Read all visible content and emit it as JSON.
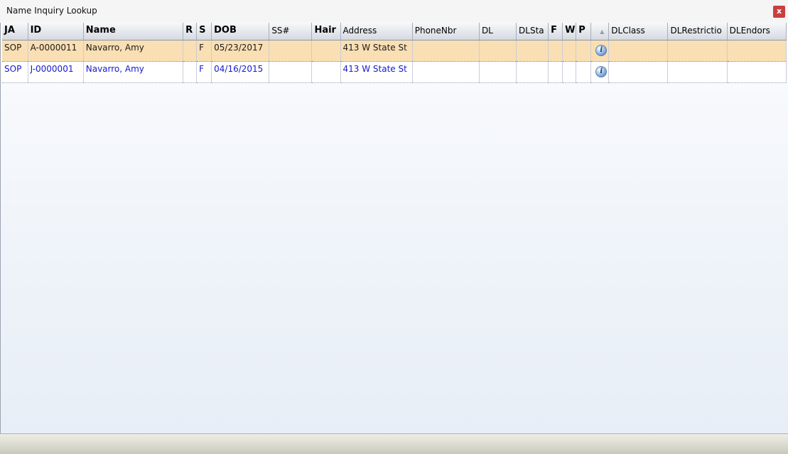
{
  "window": {
    "title": "Name Inquiry Lookup",
    "close_label": "x"
  },
  "grid": {
    "columns": [
      {
        "key": "ja",
        "label": "JA",
        "bold": true
      },
      {
        "key": "id",
        "label": "ID",
        "bold": true
      },
      {
        "key": "name",
        "label": "Name",
        "bold": true
      },
      {
        "key": "r",
        "label": "R",
        "bold": true
      },
      {
        "key": "s",
        "label": "S",
        "bold": true
      },
      {
        "key": "dob",
        "label": "DOB",
        "bold": true
      },
      {
        "key": "ss",
        "label": "SS#",
        "bold": false
      },
      {
        "key": "hair",
        "label": "Hair",
        "bold": true
      },
      {
        "key": "address",
        "label": "Address",
        "bold": false
      },
      {
        "key": "phone",
        "label": "PhoneNbr",
        "bold": false
      },
      {
        "key": "dl",
        "label": "DL",
        "bold": false
      },
      {
        "key": "dlsta",
        "label": "DLSta",
        "bold": false
      },
      {
        "key": "f",
        "label": "F",
        "bold": true
      },
      {
        "key": "w",
        "label": "W",
        "bold": true
      },
      {
        "key": "p",
        "label": "P",
        "bold": true
      },
      {
        "key": "info",
        "label": "",
        "bold": false,
        "sort_indicator": "▲"
      },
      {
        "key": "dlclass",
        "label": "DLClass",
        "bold": false
      },
      {
        "key": "dlrestriction",
        "label": "DLRestrictio",
        "bold": false
      },
      {
        "key": "dlendors",
        "label": "DLEndors",
        "bold": false
      }
    ],
    "rows": [
      {
        "selected": true,
        "ja": "SOP",
        "id": "A-0000011",
        "name": "Navarro, Amy",
        "r": "",
        "s": "F",
        "dob": "05/23/2017",
        "ss": "",
        "hair": "",
        "address": "413 W State St",
        "phone": "",
        "dl": "",
        "dlsta": "",
        "f": "",
        "w": "",
        "p": "",
        "info": "info-icon",
        "dlclass": "",
        "dlrestriction": "",
        "dlendors": ""
      },
      {
        "selected": false,
        "ja": "SOP",
        "id": "J-0000001",
        "name": "Navarro, Amy",
        "r": "",
        "s": "F",
        "dob": "04/16/2015",
        "ss": "",
        "hair": "",
        "address": "413 W State St",
        "phone": "",
        "dl": "",
        "dlsta": "",
        "f": "",
        "w": "",
        "p": "",
        "info": "info-icon",
        "dlclass": "",
        "dlrestriction": "",
        "dlendors": ""
      }
    ]
  },
  "colors": {
    "selected_row_bg": "#f9dfb3",
    "normal_row_text": "#1818cc",
    "close_button_bg": "#c9403f"
  }
}
